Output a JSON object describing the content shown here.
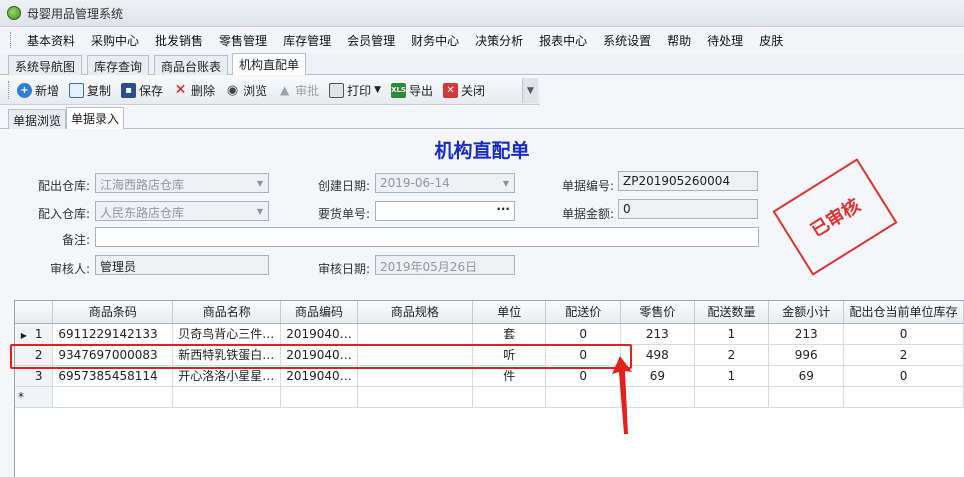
{
  "app": {
    "title": "母婴用品管理系统"
  },
  "menu": [
    "基本资料",
    "采购中心",
    "批发销售",
    "零售管理",
    "库存管理",
    "会员管理",
    "财务中心",
    "决策分析",
    "报表中心",
    "系统设置",
    "帮助",
    "待处理",
    "皮肤"
  ],
  "tabs": [
    "系统导航图",
    "库存查询",
    "商品台账表",
    "机构直配单"
  ],
  "active_tab": "机构直配单",
  "toolbar": {
    "add": "新增",
    "copy": "复制",
    "save": "保存",
    "delete": "删除",
    "view": "浏览",
    "audit": "审批",
    "print": "打印",
    "export": "导出",
    "close": "关闭"
  },
  "subtabs": [
    "单据浏览",
    "单据录入"
  ],
  "form": {
    "title": "机构直配单",
    "out_warehouse_label": "配出仓库:",
    "out_warehouse": "江海西路店仓库",
    "in_warehouse_label": "配入仓库:",
    "in_warehouse": "人民东路店仓库",
    "remark_label": "备注:",
    "remark": "",
    "auditor_label": "审核人:",
    "auditor": "管理员",
    "create_date_label": "创建日期:",
    "create_date": "2019-06-14",
    "request_no_label": "要货单号:",
    "request_no": "",
    "audit_date_label": "审核日期:",
    "audit_date": "2019年05月26日",
    "doc_no_label": "单据编号:",
    "doc_no": "ZP201905260004",
    "amount_label": "单据金额:",
    "amount": "0",
    "stamp": "已审核"
  },
  "grid": {
    "columns": [
      "商品条码",
      "商品名称",
      "商品编码",
      "商品规格",
      "单位",
      "配送价",
      "零售价",
      "配送数量",
      "金额小计",
      "配出仓当前单位库存"
    ],
    "rows": [
      {
        "no": "1",
        "indicator": "▶",
        "barcode": "6911229142133",
        "name": "贝奇鸟背心三件…",
        "code": "2019040…",
        "spec": "",
        "unit": "套",
        "dist_price": "0",
        "retail_price": "213",
        "qty": "1",
        "subtotal": "213",
        "stock": "0"
      },
      {
        "no": "2",
        "indicator": "",
        "barcode": "9347697000083",
        "name": "新西特乳铁蛋白…",
        "code": "2019040…",
        "spec": "",
        "unit": "听",
        "dist_price": "0",
        "retail_price": "498",
        "qty": "2",
        "subtotal": "996",
        "stock": "2"
      },
      {
        "no": "3",
        "indicator": "",
        "barcode": "6957385458114",
        "name": "开心洛洛小星星…",
        "code": "2019040…",
        "spec": "",
        "unit": "件",
        "dist_price": "0",
        "retail_price": "69",
        "qty": "1",
        "subtotal": "69",
        "stock": "0"
      }
    ],
    "new_row_marker": "*"
  },
  "colors": {
    "accent_title": "#1a2dbd",
    "stamp": "#d33333",
    "annotation": "#e2211c"
  }
}
